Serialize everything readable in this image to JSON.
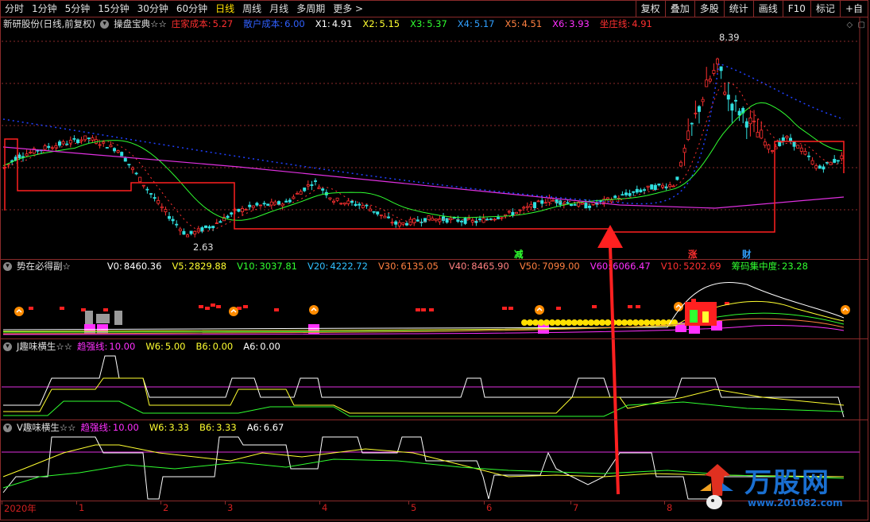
{
  "toolbar": {
    "periods": [
      "分时",
      "1分钟",
      "5分钟",
      "15分钟",
      "30分钟",
      "60分钟",
      "日线",
      "周线",
      "月线",
      "多周期",
      "更多 >"
    ],
    "active_index": 6,
    "right_buttons": [
      "复权",
      "叠加",
      "多股",
      "统计",
      "画线",
      "F10",
      "标记",
      "+自"
    ]
  },
  "main_pane": {
    "stock_title": "新研股份(日线,前复权)",
    "indicator_name": "操盘宝典☆☆",
    "params": [
      {
        "label": "庄家成本:",
        "value": "5.27",
        "color": "#ff3030"
      },
      {
        "label": "散户成本:",
        "value": "6.00",
        "color": "#3060ff"
      },
      {
        "label": "X1:",
        "value": "4.91",
        "color": "#ffffff"
      },
      {
        "label": "X2:",
        "value": "5.15",
        "color": "#ffff30"
      },
      {
        "label": "X3:",
        "value": "5.37",
        "color": "#30ff30"
      },
      {
        "label": "X4:",
        "value": "5.17",
        "color": "#30a0ff"
      },
      {
        "label": "X5:",
        "value": "4.51",
        "color": "#ff8040"
      },
      {
        "label": "X6:",
        "value": "3.93",
        "color": "#ff30ff"
      },
      {
        "label": "坐庄线:",
        "value": "4.91",
        "color": "#ff3030"
      }
    ],
    "high_label": "8.39",
    "low_label": "2.63",
    "markers": [
      {
        "text": "减",
        "color": "#30ff30"
      },
      {
        "text": "涨",
        "color": "#ff3030"
      },
      {
        "text": "财",
        "color": "#30a0ff"
      }
    ]
  },
  "vol_pane": {
    "indicator_name": "势在必得副☆",
    "params": [
      {
        "label": "V0:",
        "value": "8460.36",
        "color": "#ffffff"
      },
      {
        "label": "V5:",
        "value": "2829.88",
        "color": "#ffff30"
      },
      {
        "label": "V10:",
        "value": "3037.81",
        "color": "#30ff30"
      },
      {
        "label": "V20:",
        "value": "4222.72",
        "color": "#30c0ff"
      },
      {
        "label": "V30:",
        "value": "6135.05",
        "color": "#ff8040"
      },
      {
        "label": "V40:",
        "value": "8465.90",
        "color": "#ff8080"
      },
      {
        "label": "V50:",
        "value": "7099.00",
        "color": "#ff8040"
      },
      {
        "label": "V60:",
        "value": "6066.47",
        "color": "#ff30ff"
      },
      {
        "label": "V10:",
        "value": "5202.69",
        "color": "#ff3030"
      },
      {
        "label": "筹码集中度:",
        "value": "23.28",
        "color": "#30ff30"
      }
    ]
  },
  "j_pane": {
    "indicator_name": "J趣味横生☆☆",
    "params": [
      {
        "label": "趋强线:",
        "value": "10.00",
        "color": "#ff30ff"
      },
      {
        "label": "W6:",
        "value": "5.00",
        "color": "#ffff30"
      },
      {
        "label": "B6:",
        "value": "0.00",
        "color": "#ffff30"
      },
      {
        "label": "A6:",
        "value": "0.00",
        "color": "#ffffff"
      }
    ]
  },
  "v_pane": {
    "indicator_name": "V趣味横生☆☆",
    "params": [
      {
        "label": "趋强线:",
        "value": "10.00",
        "color": "#ff30ff"
      },
      {
        "label": "W6:",
        "value": "3.33",
        "color": "#ffff30"
      },
      {
        "label": "B6:",
        "value": "3.33",
        "color": "#ffff30"
      },
      {
        "label": "A6:",
        "value": "6.67",
        "color": "#ffffff"
      }
    ]
  },
  "x_axis": {
    "labels": [
      "2020年",
      "1",
      "2",
      "3",
      "4",
      "5",
      "6",
      "7",
      "8"
    ]
  },
  "watermark": {
    "brand": "万股网",
    "url": "www.201082.com"
  },
  "colors": {
    "grid_red": "#8a2a2a",
    "up": "#ff3030",
    "down": "#30e0e0",
    "arrow": "#ff2020",
    "brand_blue": "#1a6fd0"
  }
}
